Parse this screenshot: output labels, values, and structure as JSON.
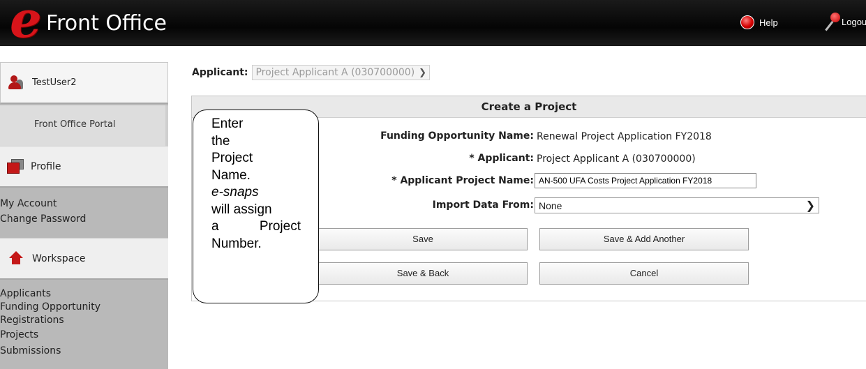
{
  "header": {
    "logo_letter": "e",
    "app_title": "Front Office",
    "help_label": "Help",
    "logout_label": "Logout",
    "icons": {
      "help": "help-icon",
      "logout": "key-icon"
    }
  },
  "sidebar": {
    "user": {
      "name": "TestUser2",
      "icon": "user-icon"
    },
    "portal_label": "Front Office Portal",
    "profile": {
      "label": "Profile",
      "icon": "profile-icon",
      "links": [
        "My Account",
        "Change Password"
      ]
    },
    "workspace": {
      "label": "Workspace",
      "icon": "home-icon",
      "links": [
        "Applicants",
        "Funding Opportunity",
        "Registrations",
        "Projects",
        "Submissions"
      ]
    }
  },
  "main": {
    "applicant_label": "Applicant:",
    "applicant_selected": "Project Applicant A (030700000)",
    "form": {
      "title": "Create a Project",
      "funding_label": "Funding Opportunity Name:",
      "funding_value": "Renewal Project Application FY2018",
      "applicant_label": "* Applicant:",
      "applicant_value": "Project Applicant A (030700000)",
      "project_name_label": "* Applicant Project Name:",
      "project_name_value": "AN-500 UFA Costs Project Application FY2018",
      "import_label": "Import Data From:",
      "import_value": "None",
      "buttons": {
        "save": "Save",
        "save_add": "Save & Add Another",
        "save_back": "Save & Back",
        "cancel": "Cancel"
      }
    }
  },
  "callout": {
    "lines": [
      "Enter",
      "the",
      "Project",
      "Name.",
      "e-snaps",
      "will assign",
      "a",
      "Project",
      "Number."
    ]
  }
}
